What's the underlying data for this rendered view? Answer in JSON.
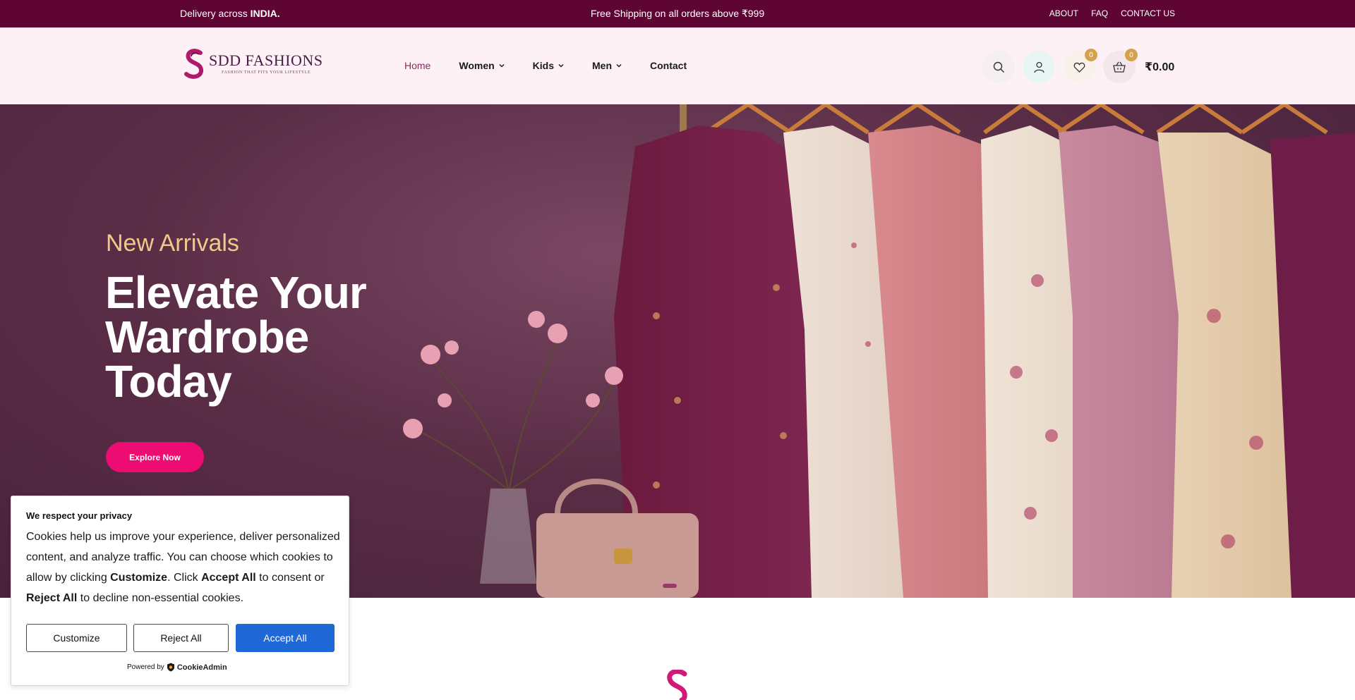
{
  "topbar": {
    "delivery_prefix": "Delivery across ",
    "delivery_country": "INDIA.",
    "shipping": "Free Shipping on all orders above ₹999",
    "links": [
      "ABOUT",
      "FAQ",
      "CONTACT US"
    ]
  },
  "logo": {
    "name": "SDD FASHIONS",
    "tagline": "FASHION THAT FITS YOUR LIFESTYLE"
  },
  "nav": {
    "items": [
      {
        "label": "Home"
      },
      {
        "label": "Women"
      },
      {
        "label": "Kids"
      },
      {
        "label": "Men"
      },
      {
        "label": "Contact"
      }
    ]
  },
  "header_icons": {
    "wishlist_count": "0",
    "cart_count": "0",
    "cart_total": "₹0.00"
  },
  "hero": {
    "eyebrow": "New Arrivals",
    "title": "Elevate Your Wardrobe Today",
    "button": "Explore Now"
  },
  "cookie": {
    "title": "We respect your privacy",
    "text_1": "Cookies help us improve your experience, deliver personalized content, and analyze traffic. You can choose which cookies to allow by clicking ",
    "bold_customize": "Customize",
    "text_2": ". Click ",
    "bold_accept": "Accept All",
    "text_3": " to consent or ",
    "bold_reject": "Reject All",
    "text_4": " to decline non-essential cookies.",
    "btn_customize": "Customize",
    "btn_reject": "Reject All",
    "btn_accept": "Accept All",
    "powered_by": "Powered by",
    "powered_brand": "CookieAdmin"
  },
  "colors": {
    "topbar": "#5e0534",
    "accent_pink": "#ec0c72",
    "gold": "#f0c98a",
    "accept_blue": "#1e68d8"
  }
}
